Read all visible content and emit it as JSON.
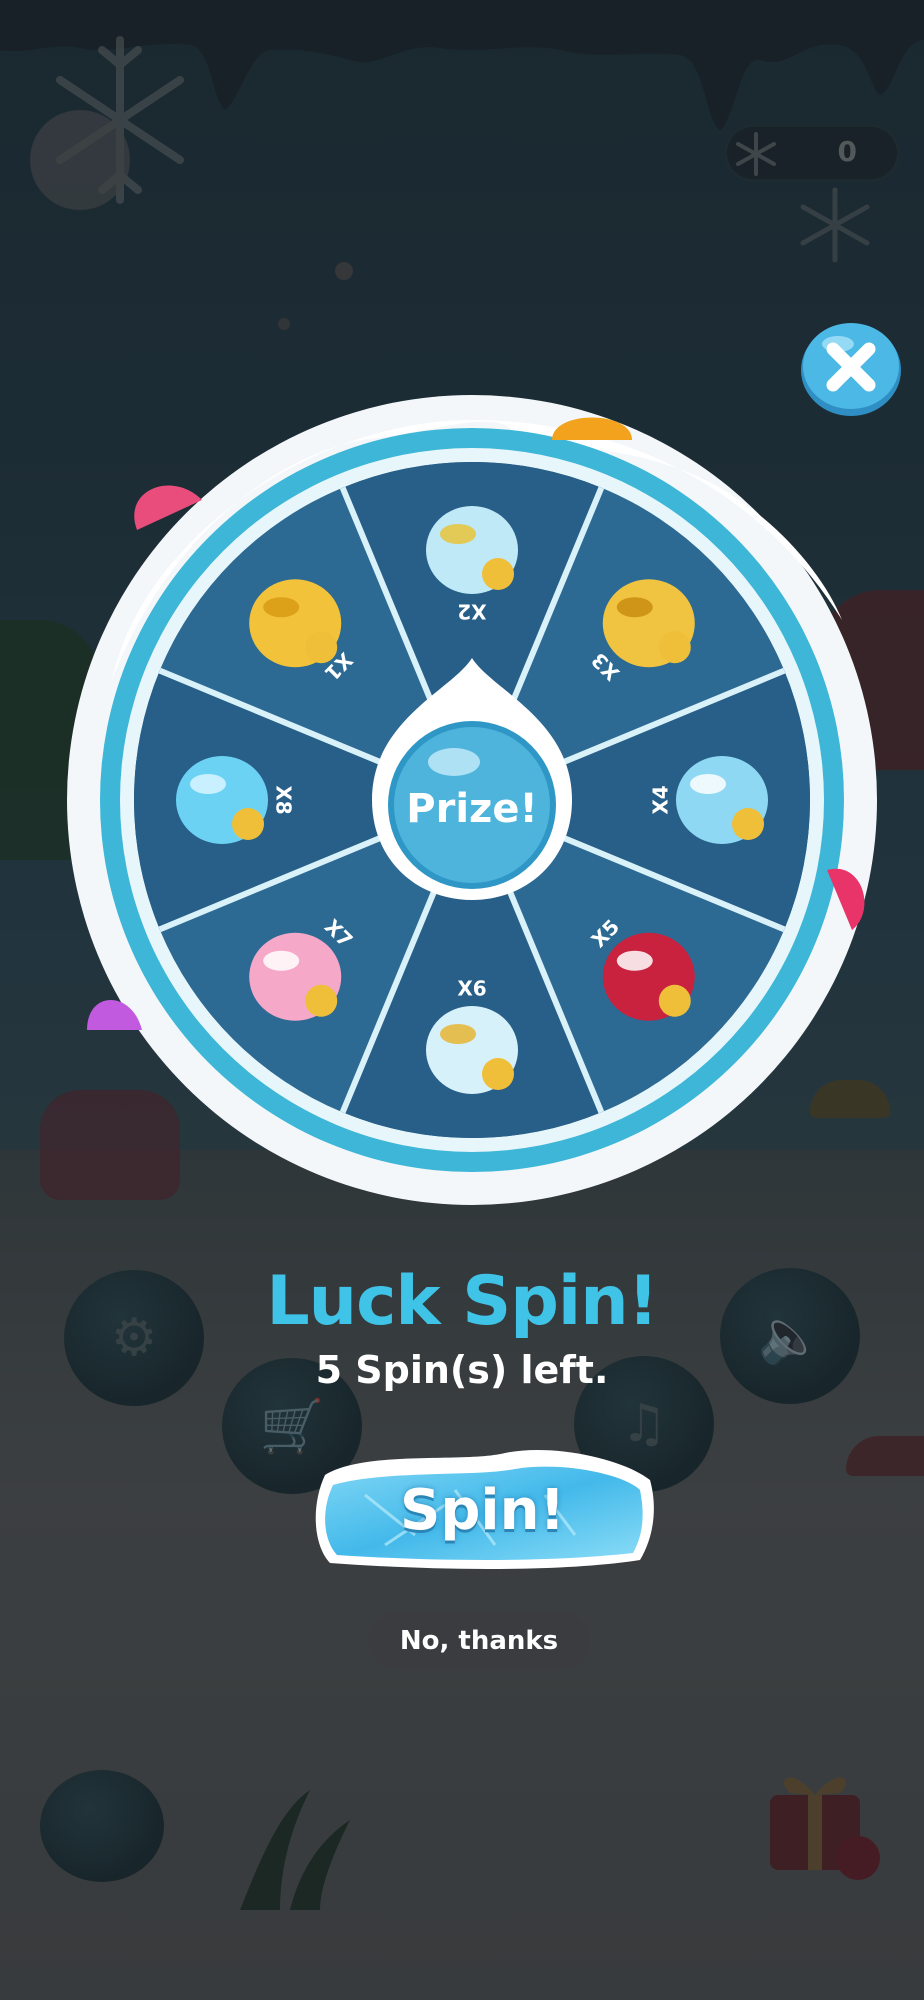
{
  "wheel": {
    "center_label": "Prize!",
    "segments": [
      {
        "multiplier": "X1",
        "prize": "coins-pile-icon"
      },
      {
        "multiplier": "X2",
        "prize": "ice-cube-coins-icon"
      },
      {
        "multiplier": "X3",
        "prize": "coin-stacks-icon"
      },
      {
        "multiplier": "X4",
        "prize": "ice-crystal-coins-icon"
      },
      {
        "multiplier": "X5",
        "prize": "santa-sack-icon"
      },
      {
        "multiplier": "X6",
        "prize": "igloo-chest-icon"
      },
      {
        "multiplier": "X7",
        "prize": "pink-gem-icon"
      },
      {
        "multiplier": "X8",
        "prize": "blue-diamond-icon"
      }
    ]
  },
  "popup": {
    "title": "Luck Spin!",
    "spins_left": "5 Spin(s) left.",
    "spin_button": "Spin!",
    "decline_button": "No, thanks"
  },
  "hud": {
    "coin_count": "0"
  },
  "colors": {
    "title": "#3fc3e6",
    "wheel_segment": "#2a5f86",
    "wheel_ring": "#3db6d8",
    "snow": "#ffffff"
  }
}
